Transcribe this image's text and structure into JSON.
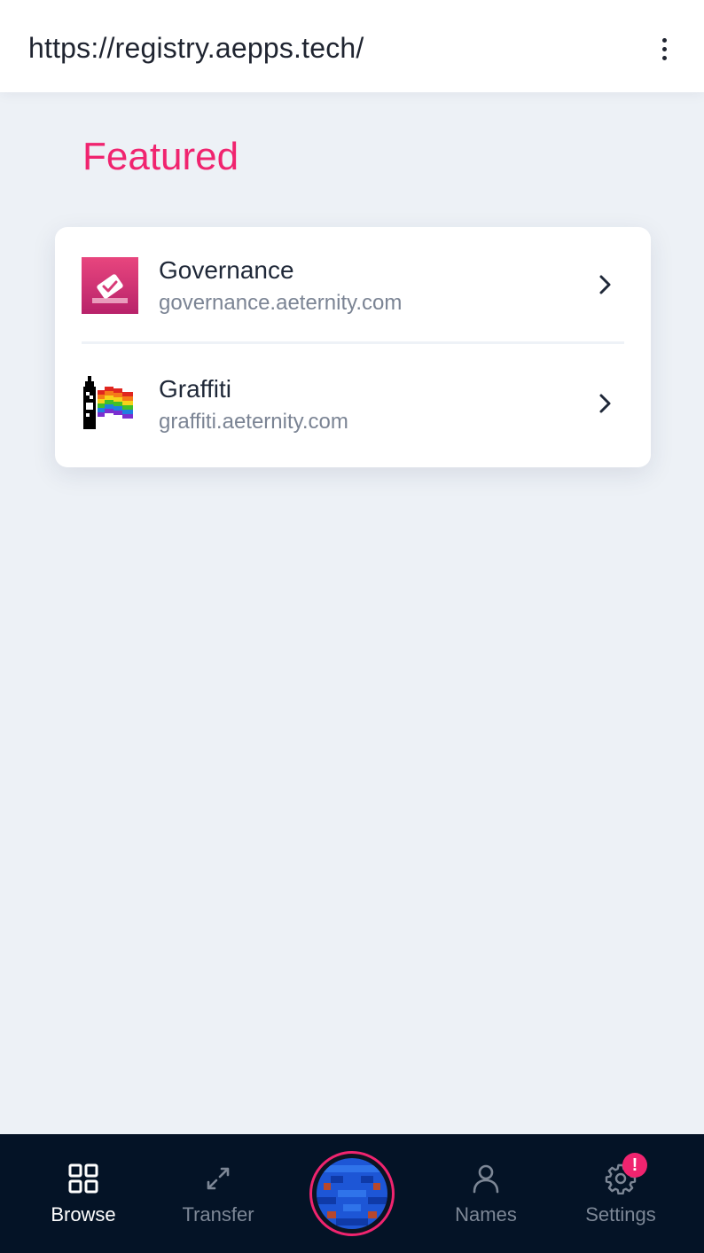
{
  "address_bar": {
    "url": "https://registry.aepps.tech/"
  },
  "featured": {
    "title": "Featured",
    "apps": [
      {
        "name": "Governance",
        "url": "governance.aeternity.com",
        "icon": "governance-logo-icon"
      },
      {
        "name": "Graffiti",
        "url": "graffiti.aeternity.com",
        "icon": "graffiti-logo-icon"
      }
    ]
  },
  "tab_bar": {
    "tabs": [
      {
        "label": "Browse",
        "icon": "grid-icon",
        "active": true
      },
      {
        "label": "Transfer",
        "icon": "transfer-arrows-icon",
        "active": false
      },
      {
        "label": "Names",
        "icon": "user-icon",
        "active": false
      },
      {
        "label": "Settings",
        "icon": "gear-icon",
        "active": false
      }
    ],
    "settings_badge": "!",
    "account_avatar": "identicon-avatar"
  },
  "colors": {
    "accent": "#f0246f",
    "background": "#edf1f6",
    "tab_bar": "#041326",
    "muted_text": "#7b8494"
  }
}
